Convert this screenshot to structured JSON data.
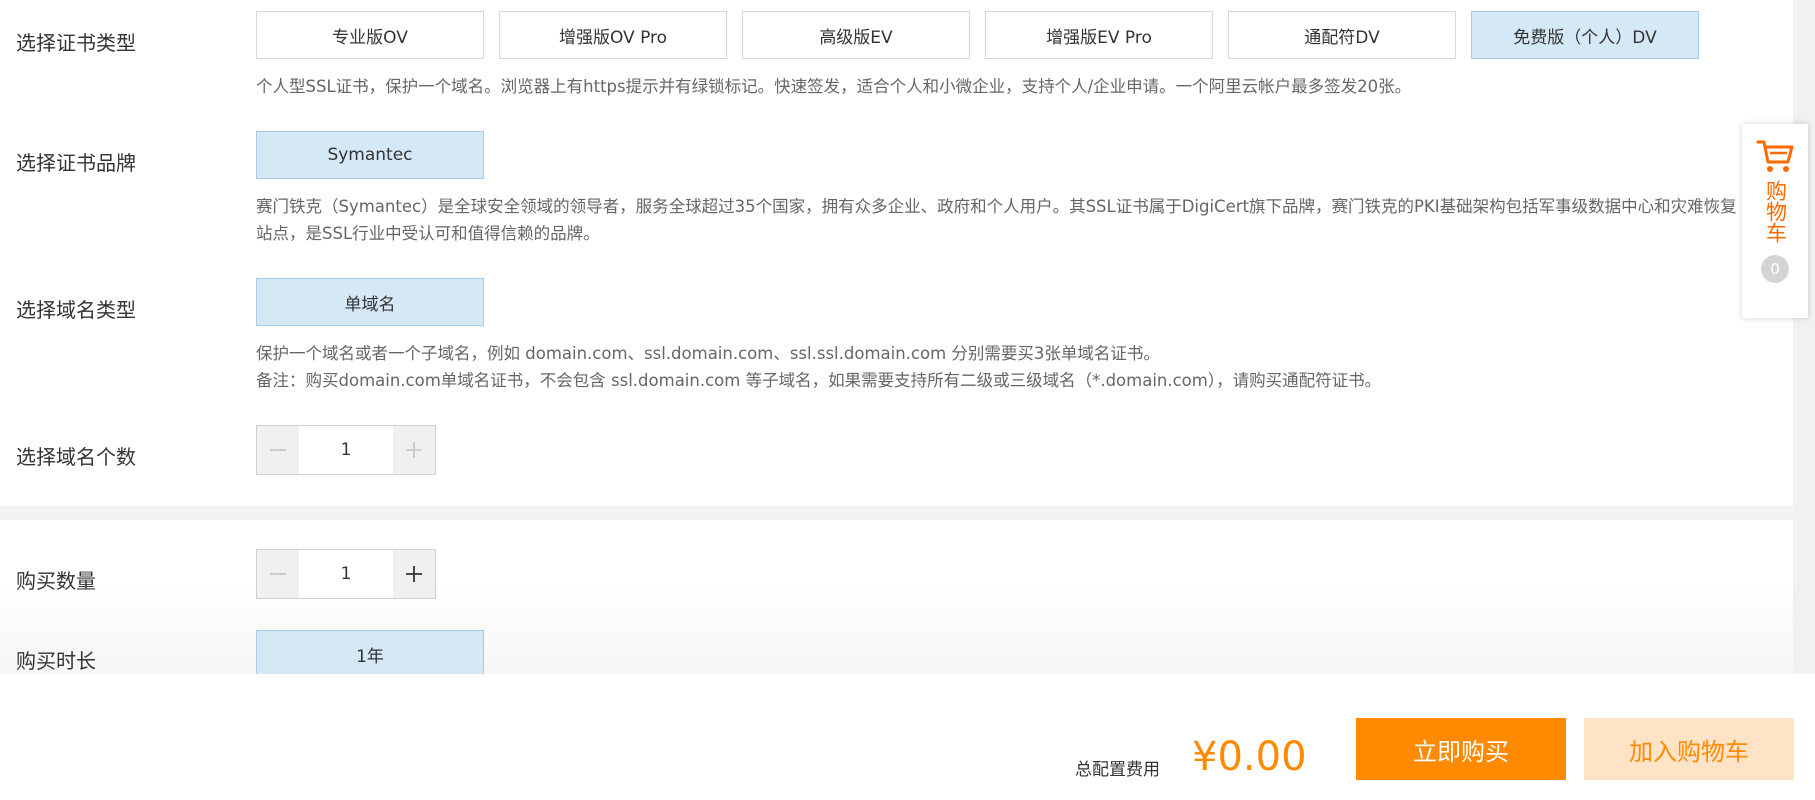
{
  "cert_type": {
    "label": "选择证书类型",
    "options": [
      "专业版OV",
      "增强版OV Pro",
      "高级版EV",
      "增强版EV Pro",
      "通配符DV",
      "免费版（个人）DV"
    ],
    "selected": "免费版（个人）DV",
    "description": "个人型SSL证书，保护一个域名。浏览器上有https提示并有绿锁标记。快速签发，适合个人和小微企业，支持个人/企业申请。一个阿里云帐户最多签发20张。"
  },
  "cert_brand": {
    "label": "选择证书品牌",
    "option": "Symantec",
    "description": "赛门铁克（Symantec）是全球安全领域的领导者，服务全球超过35个国家，拥有众多企业、政府和个人用户。其SSL证书属于DigiCert旗下品牌，赛门铁克的PKI基础架构包括军事级数据中心和灾难恢复站点，是SSL行业中受认可和值得信赖的品牌。"
  },
  "domain_type": {
    "label": "选择域名类型",
    "option": "单域名",
    "description_line1": "保护一个域名或者一个子域名，例如 domain.com、ssl.domain.com、ssl.ssl.domain.com 分别需要买3张单域名证书。",
    "description_line2": "备注：购买domain.com单域名证书，不会包含 ssl.domain.com 等子域名，如果需要支持所有二级或三级域名（*.domain.com），请购买通配符证书。"
  },
  "domain_count": {
    "label": "选择域名个数",
    "value": "1"
  },
  "purchase_quantity": {
    "label": "购买数量",
    "value": "1"
  },
  "purchase_duration": {
    "label": "购买时长",
    "option": "1年"
  },
  "cart": {
    "label": "购物车",
    "count": "0"
  },
  "footer": {
    "cost_label": "总配置费用",
    "cost_value": "¥0.00",
    "buy_now": "立即购买",
    "add_to_cart": "加入购物车"
  },
  "colors": {
    "accent": "#ff8a00",
    "selected_bg": "#d5e8f6",
    "selected_border": "#a6cbea"
  }
}
